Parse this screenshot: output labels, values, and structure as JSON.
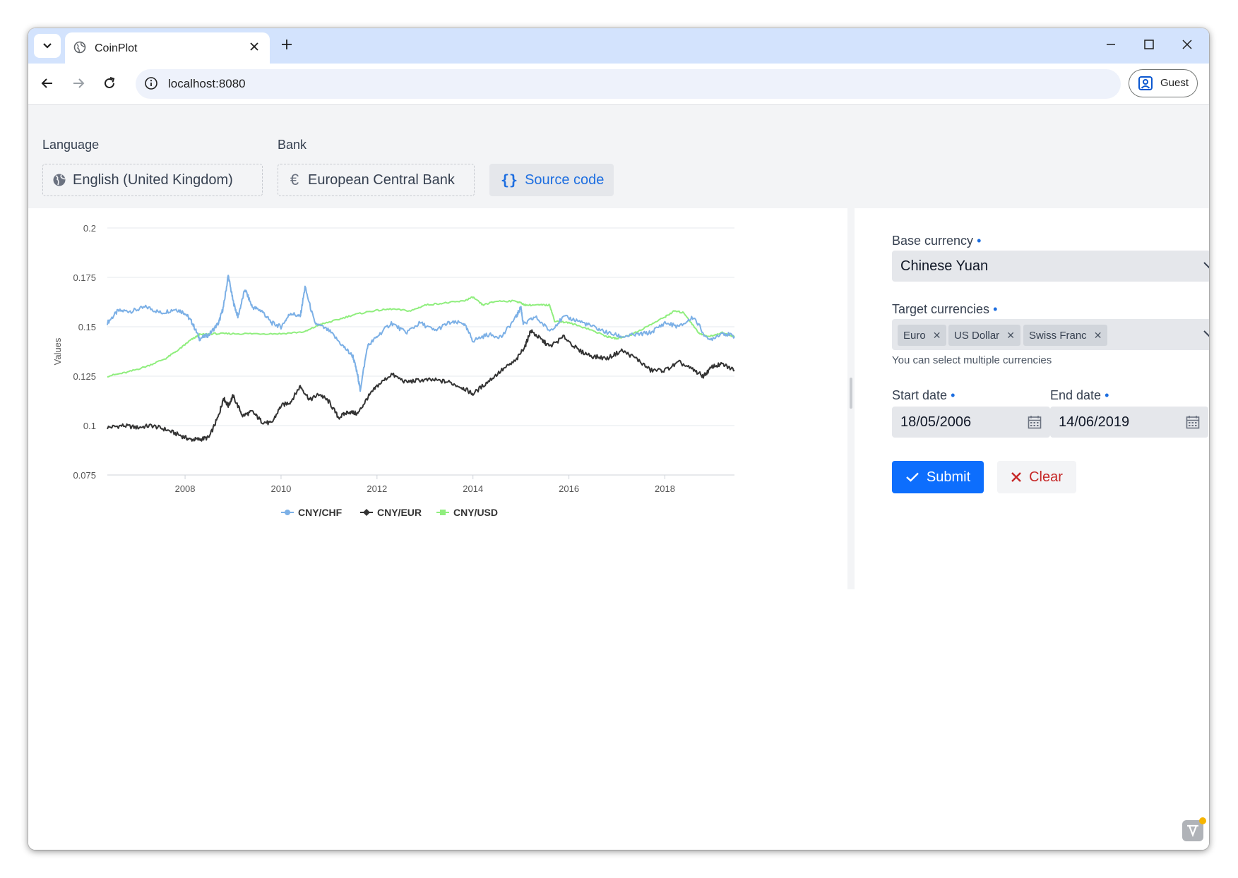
{
  "browser": {
    "tab_title": "CoinPlot",
    "url": "localhost:8080",
    "profile_label": "Guest"
  },
  "topbar": {
    "language_label": "Language",
    "language_value": "English (United Kingdom)",
    "bank_label": "Bank",
    "bank_value": "European Central Bank",
    "bank_icon": "€",
    "source_code_label": "Source code",
    "source_code_icon": "{}"
  },
  "form": {
    "base_currency_label": "Base currency",
    "base_currency_value": "Chinese Yuan",
    "target_currencies_label": "Target currencies",
    "target_currencies": [
      "Euro",
      "US Dollar",
      "Swiss Franc"
    ],
    "target_help": "You can select multiple currencies",
    "start_date_label": "Start date",
    "start_date_value": "18/05/2006",
    "end_date_label": "End date",
    "end_date_value": "14/06/2019",
    "required_marker": "•",
    "submit_label": "Submit",
    "clear_label": "Clear"
  },
  "colors": {
    "accent": "#0d6efd",
    "clear": "#c62828",
    "chf": "#7cb0e6",
    "eur": "#333333",
    "usd": "#90ee7e"
  },
  "chart_data": {
    "type": "line",
    "title": "",
    "xlabel": "",
    "ylabel": "Values",
    "ylim": [
      0.075,
      0.2
    ],
    "yticks": [
      "0.2",
      "0.175",
      "0.15",
      "0.125",
      "0.1",
      "0.075"
    ],
    "xlim": [
      2006.38,
      2019.45
    ],
    "xticks": [
      "2008",
      "2010",
      "2012",
      "2014",
      "2016",
      "2018"
    ],
    "grid": true,
    "legend_position": "bottom",
    "series": [
      {
        "name": "CNY/CHF",
        "color": "#7cb0e6",
        "x": [
          2006.38,
          2006.6,
          2006.9,
          2007.2,
          2007.5,
          2007.8,
          2008.0,
          2008.15,
          2008.3,
          2008.5,
          2008.7,
          2008.8,
          2008.9,
          2009.0,
          2009.1,
          2009.25,
          2009.4,
          2009.6,
          2009.8,
          2010.0,
          2010.2,
          2010.4,
          2010.5,
          2010.7,
          2011.0,
          2011.3,
          2011.5,
          2011.6,
          2011.65,
          2011.8,
          2012.0,
          2012.3,
          2012.6,
          2012.9,
          2013.2,
          2013.5,
          2013.8,
          2014.0,
          2014.3,
          2014.6,
          2014.9,
          2015.0,
          2015.05,
          2015.3,
          2015.6,
          2015.9,
          2016.2,
          2016.5,
          2016.8,
          2017.1,
          2017.4,
          2017.7,
          2018.0,
          2018.3,
          2018.6,
          2018.9,
          2019.2,
          2019.45
        ],
        "y": [
          0.152,
          0.158,
          0.158,
          0.16,
          0.157,
          0.159,
          0.157,
          0.152,
          0.144,
          0.146,
          0.152,
          0.16,
          0.176,
          0.163,
          0.155,
          0.169,
          0.16,
          0.158,
          0.152,
          0.15,
          0.157,
          0.155,
          0.17,
          0.152,
          0.148,
          0.14,
          0.135,
          0.125,
          0.118,
          0.14,
          0.145,
          0.152,
          0.147,
          0.152,
          0.148,
          0.152,
          0.152,
          0.143,
          0.146,
          0.145,
          0.155,
          0.16,
          0.151,
          0.155,
          0.148,
          0.155,
          0.153,
          0.15,
          0.147,
          0.145,
          0.146,
          0.147,
          0.152,
          0.15,
          0.155,
          0.143,
          0.147,
          0.145
        ]
      },
      {
        "name": "CNY/EUR",
        "color": "#333333",
        "x": [
          2006.38,
          2006.7,
          2007.0,
          2007.3,
          2007.6,
          2007.9,
          2008.1,
          2008.3,
          2008.5,
          2008.7,
          2008.8,
          2008.9,
          2009.0,
          2009.2,
          2009.4,
          2009.6,
          2009.8,
          2010.0,
          2010.2,
          2010.4,
          2010.6,
          2010.8,
          2011.0,
          2011.2,
          2011.4,
          2011.6,
          2011.8,
          2012.0,
          2012.3,
          2012.6,
          2012.9,
          2013.2,
          2013.5,
          2013.8,
          2014.0,
          2014.3,
          2014.6,
          2014.9,
          2015.1,
          2015.2,
          2015.4,
          2015.6,
          2015.9,
          2016.2,
          2016.5,
          2016.8,
          2017.1,
          2017.4,
          2017.7,
          2018.0,
          2018.3,
          2018.6,
          2018.8,
          2019.0,
          2019.2,
          2019.45
        ],
        "y": [
          0.099,
          0.1,
          0.099,
          0.1,
          0.098,
          0.095,
          0.093,
          0.093,
          0.094,
          0.105,
          0.114,
          0.11,
          0.115,
          0.105,
          0.107,
          0.102,
          0.101,
          0.11,
          0.112,
          0.12,
          0.113,
          0.116,
          0.112,
          0.104,
          0.107,
          0.106,
          0.114,
          0.12,
          0.126,
          0.122,
          0.123,
          0.123,
          0.122,
          0.119,
          0.116,
          0.122,
          0.128,
          0.133,
          0.141,
          0.148,
          0.144,
          0.14,
          0.145,
          0.138,
          0.135,
          0.134,
          0.138,
          0.134,
          0.128,
          0.128,
          0.132,
          0.128,
          0.125,
          0.13,
          0.131,
          0.128
        ]
      },
      {
        "name": "CNY/USD",
        "color": "#90ee7e",
        "x": [
          2006.38,
          2006.8,
          2007.2,
          2007.6,
          2007.9,
          2008.1,
          2008.3,
          2008.6,
          2009.0,
          2009.5,
          2010.0,
          2010.5,
          2010.8,
          2011.1,
          2011.5,
          2011.9,
          2012.3,
          2012.7,
          2013.0,
          2013.4,
          2013.8,
          2014.0,
          2014.2,
          2014.5,
          2014.9,
          2015.1,
          2015.4,
          2015.6,
          2015.7,
          2016.0,
          2016.4,
          2016.8,
          2017.0,
          2017.3,
          2017.7,
          2018.0,
          2018.2,
          2018.4,
          2018.7,
          2018.9,
          2019.2,
          2019.45
        ],
        "y": [
          0.125,
          0.127,
          0.13,
          0.134,
          0.139,
          0.143,
          0.146,
          0.1465,
          0.1465,
          0.1465,
          0.1465,
          0.1475,
          0.151,
          0.153,
          0.156,
          0.158,
          0.159,
          0.158,
          0.161,
          0.162,
          0.163,
          0.165,
          0.161,
          0.163,
          0.163,
          0.161,
          0.161,
          0.161,
          0.153,
          0.152,
          0.149,
          0.145,
          0.144,
          0.146,
          0.151,
          0.155,
          0.158,
          0.157,
          0.147,
          0.145,
          0.147,
          0.145
        ]
      }
    ]
  }
}
